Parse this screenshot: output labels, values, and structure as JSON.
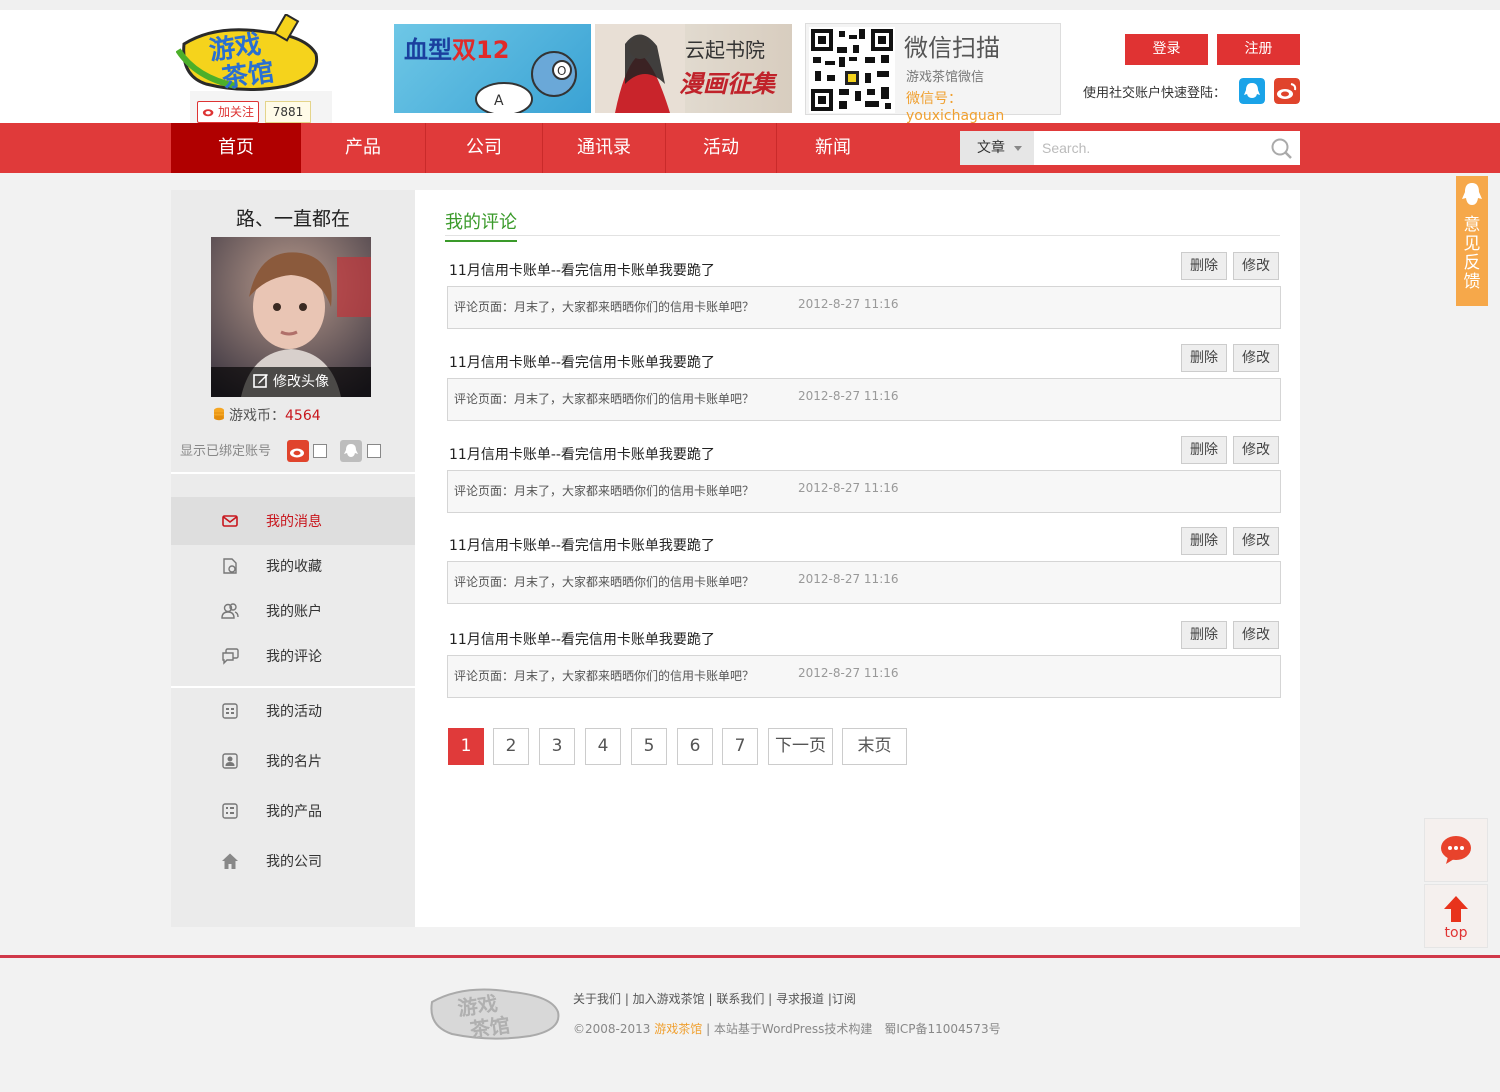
{
  "header": {
    "follow_label": "加关注",
    "follow_count": "7881",
    "ad1_text_a": "血型",
    "ad1_text_b": "双12",
    "ad2_title": "云起书院",
    "ad2_sub": "漫画征集",
    "qr_title": "微信扫描",
    "qr_sub": "游戏茶馆微信",
    "qr_id": "微信号：youxichaguan",
    "login": "登录",
    "register": "注册",
    "social_label": "使用社交账户快速登陆："
  },
  "nav": {
    "items": [
      {
        "label": "首页"
      },
      {
        "label": "产品"
      },
      {
        "label": "公司"
      },
      {
        "label": "通讯录"
      },
      {
        "label": "活动"
      },
      {
        "label": "新闻"
      }
    ],
    "search_category": "文章",
    "search_placeholder": "Search."
  },
  "sidebar": {
    "username": "路、一直都在",
    "avatar_edit": "修改头像",
    "coins_label": "游戏币：",
    "coins_value": "4564",
    "bound_label": "显示已绑定账号",
    "menu": [
      {
        "label": "我的消息",
        "icon": "mail-icon"
      },
      {
        "label": "我的收藏",
        "icon": "folder-icon"
      },
      {
        "label": "我的账户",
        "icon": "users-icon"
      },
      {
        "label": "我的评论",
        "icon": "comment-icon"
      },
      {
        "label": "我的活动",
        "icon": "activity-icon"
      },
      {
        "label": "我的名片",
        "icon": "card-icon"
      },
      {
        "label": "我的产品",
        "icon": "product-icon"
      },
      {
        "label": "我的公司",
        "icon": "home-icon"
      }
    ]
  },
  "main": {
    "section_title": "我的评论",
    "comments": [
      {
        "title": "11月信用卡账单--看完信用卡账单我要跪了",
        "text": "评论页面：月末了，大家都来晒晒你们的信用卡账单吧？",
        "time": "2012-8-27 11:16",
        "delete": "删除",
        "edit": "修改"
      },
      {
        "title": "11月信用卡账单--看完信用卡账单我要跪了",
        "text": "评论页面：月末了，大家都来晒晒你们的信用卡账单吧？",
        "time": "2012-8-27 11:16",
        "delete": "删除",
        "edit": "修改"
      },
      {
        "title": "11月信用卡账单--看完信用卡账单我要跪了",
        "text": "评论页面：月末了，大家都来晒晒你们的信用卡账单吧？",
        "time": "2012-8-27 11:16",
        "delete": "删除",
        "edit": "修改"
      },
      {
        "title": "11月信用卡账单--看完信用卡账单我要跪了",
        "text": "评论页面：月末了，大家都来晒晒你们的信用卡账单吧？",
        "time": "2012-8-27 11:16",
        "delete": "删除",
        "edit": "修改"
      },
      {
        "title": "11月信用卡账单--看完信用卡账单我要跪了",
        "text": "评论页面：月末了，大家都来晒晒你们的信用卡账单吧？",
        "time": "2012-8-27 11:16",
        "delete": "删除",
        "edit": "修改"
      }
    ],
    "pagination": [
      "1",
      "2",
      "3",
      "4",
      "5",
      "6",
      "7",
      "下一页",
      "末页"
    ]
  },
  "float": {
    "feedback": "意见反馈",
    "top": "top"
  },
  "footer": {
    "links": "关于我们 | 加入游戏茶馆 | 联系我们 | 寻求报道 |订阅",
    "copy_a": "©2008-2013 ",
    "copy_brand": "游戏茶馆",
    "copy_b": " | 本站基于WordPress技术构建　蜀ICP备11004573号"
  },
  "colors": {
    "brand_red": "#e03a3a",
    "nav_active": "#b00000",
    "accent_green": "#3a9a2a",
    "accent_orange": "#f6a84a"
  }
}
